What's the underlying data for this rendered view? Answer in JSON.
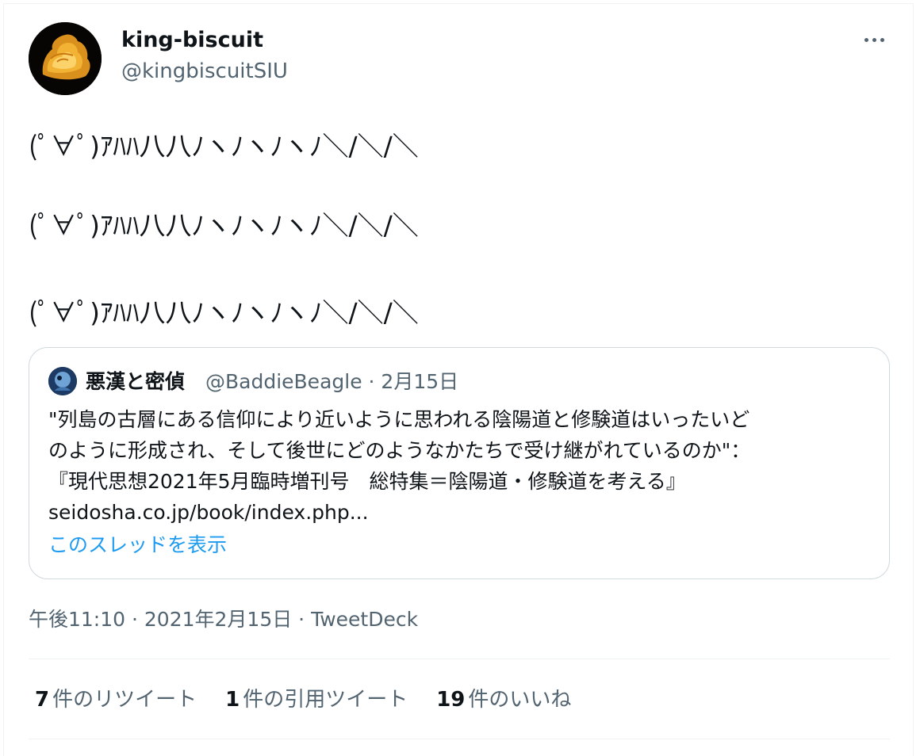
{
  "tweet": {
    "author_name": "king-biscuit",
    "author_handle": "@kingbiscuitSIU",
    "more_icon": "more-horizontal-icon",
    "lines": [
      "(ﾟ∀ﾟ)ｱﾊﾊ八八ﾉヽﾉヽﾉヽﾉ＼/＼/＼",
      "(ﾟ∀ﾟ)ｱﾊﾊ八八ﾉヽﾉヽﾉヽﾉ＼/＼/＼",
      "(ﾟ∀ﾟ)ｱﾊﾊ八八ﾉヽﾉヽﾉヽﾉ＼/＼/＼"
    ],
    "meta": "午後11:10 · 2021年2月15日 · TweetDeck"
  },
  "quote": {
    "author_name": "悪漢と密偵",
    "author_handle": "@BaddieBeagle · 2月15日",
    "text_lines": [
      "\"列島の古層にある信仰により近いように思われる陰陽道と修験道はいったいど",
      "のように形成され、そして後世にどのようなかたちで受け継がれているのか\"：",
      "『現代思想2021年5月臨時増刊号　総特集＝陰陽道・修験道を考える』",
      "seidosha.co.jp/book/index.php..."
    ],
    "show_thread": "このスレッドを表示"
  },
  "stats": [
    {
      "count": "7",
      "label": "件のリツイート"
    },
    {
      "count": "1",
      "label": "件の引用ツイート"
    },
    {
      "count": "19",
      "label": "件のいいね"
    }
  ],
  "colors": {
    "text": "#0f1419",
    "secondary": "#536471",
    "link": "#1d9bf0",
    "border": "#cfd9de"
  }
}
